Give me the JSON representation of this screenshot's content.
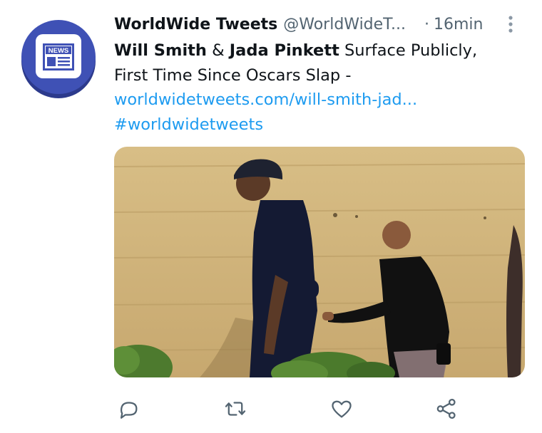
{
  "tweet": {
    "display_name": "WorldWide Tweets",
    "handle": "@WorldWideT...",
    "dot": "·",
    "time": "16min",
    "avatar_icon": "news-icon",
    "avatar_label": "NEWS",
    "text": {
      "name1": "Will Smith",
      "amp": " & ",
      "name2": "Jada Pinkett",
      "rest1": " Surface Publicly,",
      "line2": "First Time Since Oscars Slap -",
      "link": "worldwidetweets.com/will-smith-jad...",
      "hashtag": "#worldwidetweets"
    },
    "actions": [
      {
        "icon": "reply-icon"
      },
      {
        "icon": "retweet-icon"
      },
      {
        "icon": "like-icon"
      },
      {
        "icon": "share-icon"
      }
    ]
  },
  "colors": {
    "text": "#0f1419",
    "secondary": "#536471",
    "link": "#1d9bf0",
    "avatar_bg": "#3f51b5"
  }
}
